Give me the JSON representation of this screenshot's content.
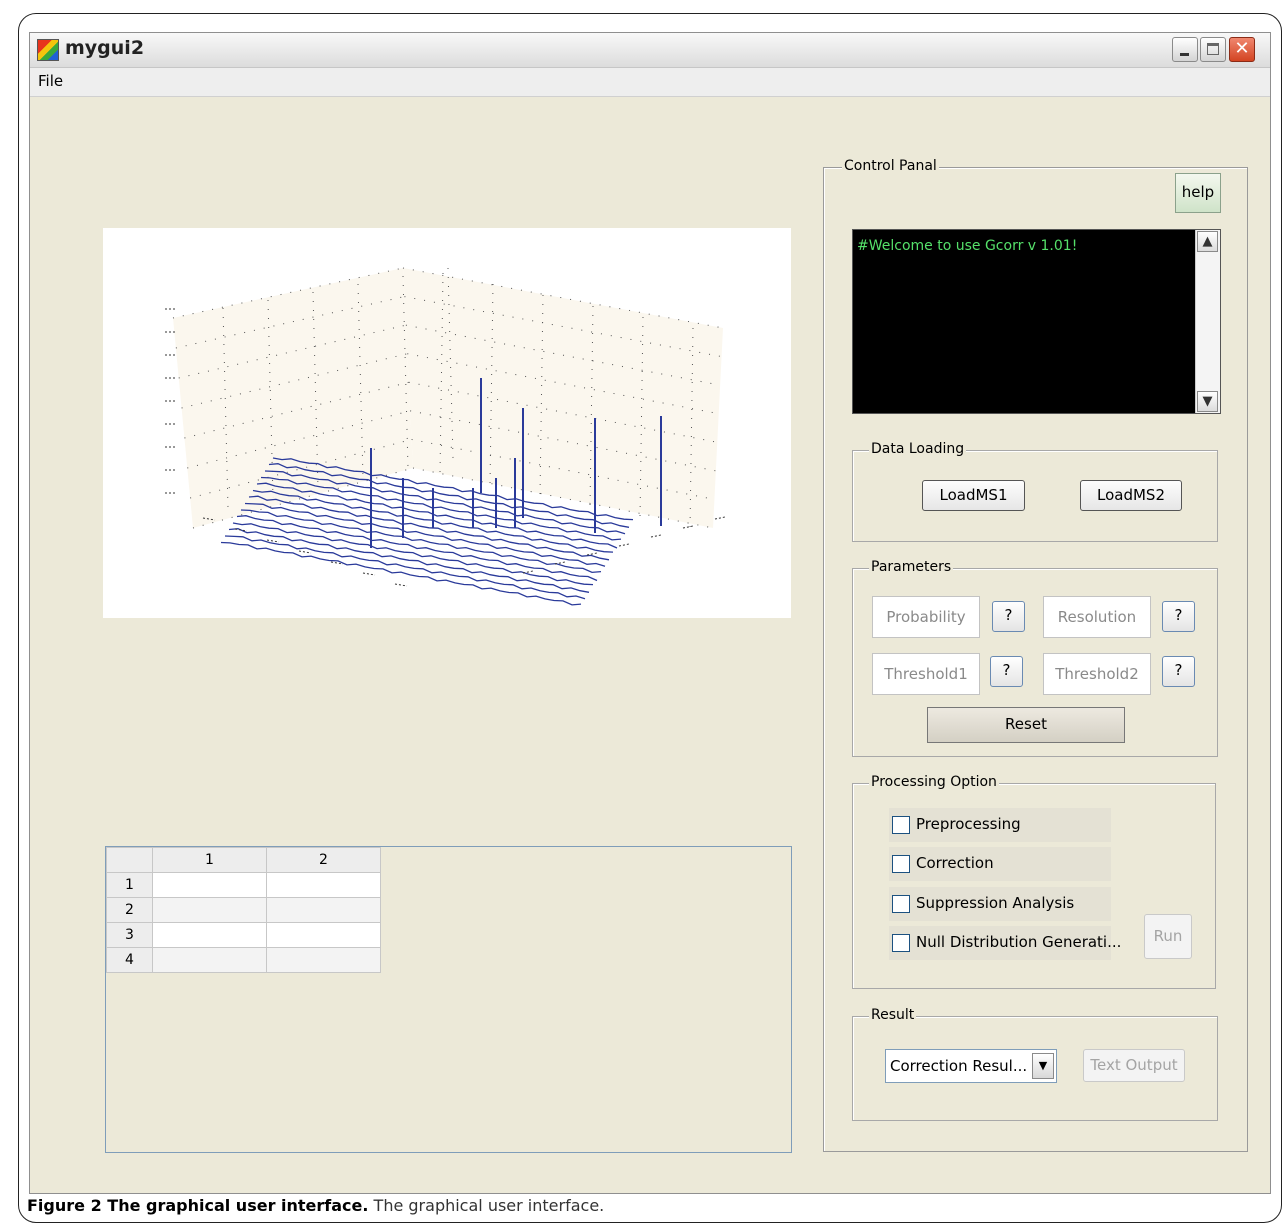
{
  "window": {
    "title": "mygui2"
  },
  "menu": {
    "file": "File"
  },
  "table": {
    "columns": [
      "1",
      "2"
    ],
    "rows": [
      "1",
      "2",
      "3",
      "4"
    ]
  },
  "control_panel": {
    "legend": "Control Panal",
    "help": "help",
    "console_text": "#Welcome to use Gcorr v 1.01!",
    "data_loading": {
      "legend": "Data Loading",
      "load1": "LoadMS1",
      "load2": "LoadMS2"
    },
    "parameters": {
      "legend": "Parameters",
      "probability": "Probability",
      "resolution": "Resolution",
      "threshold1": "Threshold1",
      "threshold2": "Threshold2",
      "help_mark": "?",
      "reset": "Reset"
    },
    "processing": {
      "legend": "Processing Option",
      "options": [
        "Preprocessing",
        "Correction",
        "Suppression Analysis",
        "Null Distribution Generati..."
      ],
      "run": "Run"
    },
    "result": {
      "legend": "Result",
      "selected": "Correction Resul...",
      "text_output": "Text Output"
    }
  },
  "caption": {
    "bold": "Figure 2 The graphical user interface.",
    "rest": " The graphical user interface."
  },
  "colors": {
    "console_text": "#55e06a",
    "plot_lines": "#2a3a9a",
    "plot_panes": "#fbf7ee"
  }
}
